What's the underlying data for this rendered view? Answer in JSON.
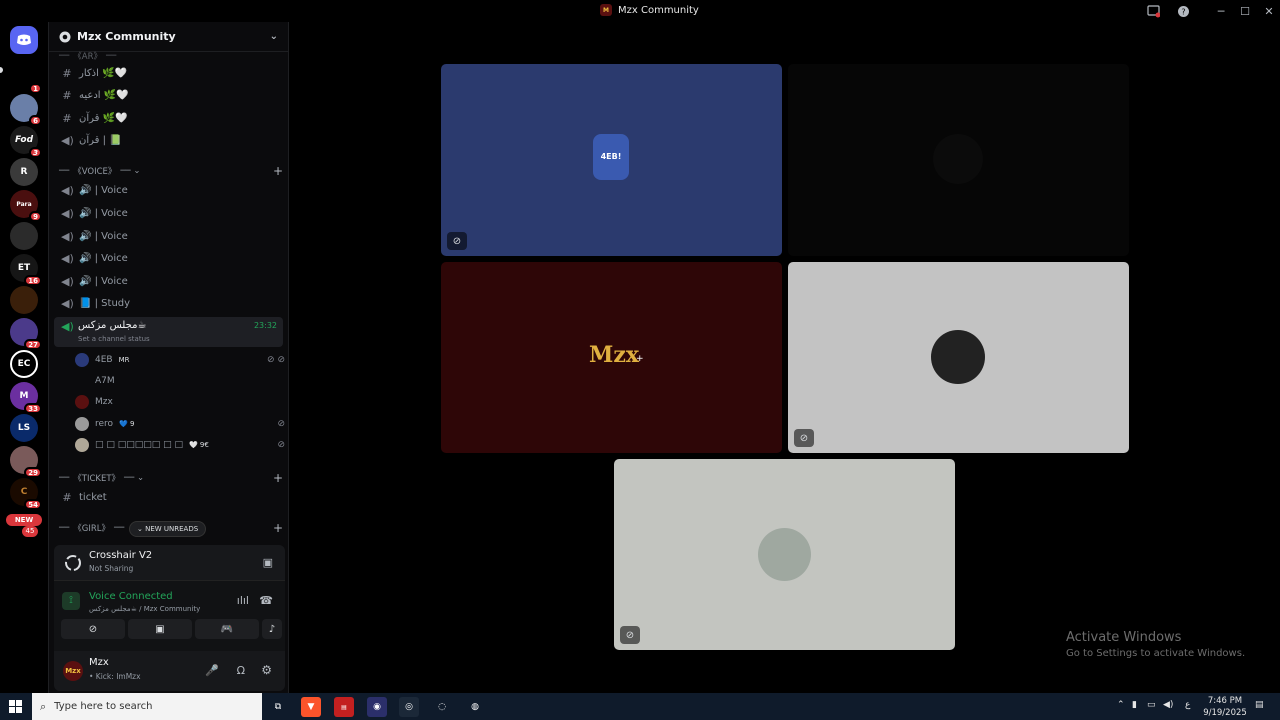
{
  "window": {
    "title": "Mzx Community"
  },
  "server": {
    "name": "Mzx Community"
  },
  "rail_badges": [
    "1",
    "6",
    "3",
    "9",
    "16",
    "27",
    "33",
    "29",
    "54",
    "NEW",
    "45"
  ],
  "top_category_cut": "《AR》",
  "text_channels_top": [
    {
      "name": "اذكار 🌿🤍"
    },
    {
      "name": "ادعيه 🌿🤍"
    },
    {
      "name": "قرآن 🌿🤍"
    },
    {
      "name": "قرآن | 📗"
    }
  ],
  "voice_category": "《VOICE》",
  "voice_channels": [
    "🔊 | Voice",
    "🔊 | Voice",
    "🔊 | Voice",
    "🔊 | Voice",
    "🔊 | Voice",
    "📘 | Study"
  ],
  "active_channel": {
    "name": "مجلس مزكس☕",
    "time": "23:32",
    "status": "Set a channel status"
  },
  "members": [
    {
      "name": "4EB",
      "tag": "MR"
    },
    {
      "name": "A7M",
      "tag": ""
    },
    {
      "name": "Mzx",
      "tag": ""
    },
    {
      "name": "rero",
      "tag": "💙 9"
    },
    {
      "name": "□ □ □□□□□ □ □",
      "tag": "🤍 9€"
    }
  ],
  "ticket_category": "《TICKET》",
  "ticket_channel": "ticket",
  "girl_category": "《GIRL》",
  "new_unreads": "NEW UNREADS",
  "stream": {
    "title": "Crosshair V2",
    "subtitle": "Not Sharing"
  },
  "voice": {
    "status": "Voice Connected",
    "location": "مجلس مزكس☕ / Mzx Community"
  },
  "user": {
    "name": "Mzx",
    "status": "• Kick: ImMzx"
  },
  "tiles": {
    "center_logo_text": "Mzx",
    "top_logo_text": "4EB!"
  },
  "activate": {
    "line1": "Activate Windows",
    "line2": "Go to Settings to activate Windows."
  },
  "taskbar": {
    "search_placeholder": "Type here to search",
    "time": "7:46 PM",
    "date": "9/19/2025",
    "lang": "ع"
  }
}
